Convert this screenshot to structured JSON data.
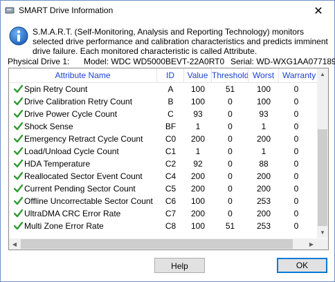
{
  "window": {
    "title": "SMART Drive Information",
    "close_glyph": "✕"
  },
  "info": {
    "text": "S.M.A.R.T. (Self-Monitoring, Analysis and Reporting Technology) monitors selected drive performance and calibration characteristics and predicts imminent drive failure. Each monitored characteristic is called Attribute."
  },
  "drive": {
    "label": "Physical Drive 1:",
    "model": "Model: WDC WD5000BEVT-22A0RT0",
    "serial": "Serial: WD-WXG1AA077189"
  },
  "table": {
    "headers": [
      "Attribute Name",
      "ID",
      "Value",
      "Threshold",
      "Worst",
      "Warranty"
    ],
    "rows": [
      {
        "name": "Spin Retry Count",
        "id": "A",
        "value": "100",
        "threshold": "51",
        "worst": "100",
        "warranty": "0"
      },
      {
        "name": "Drive Calibration Retry Count",
        "id": "B",
        "value": "100",
        "threshold": "0",
        "worst": "100",
        "warranty": "0"
      },
      {
        "name": "Drive Power Cycle Count",
        "id": "C",
        "value": "93",
        "threshold": "0",
        "worst": "93",
        "warranty": "0"
      },
      {
        "name": "Shock Sense",
        "id": "BF",
        "value": "1",
        "threshold": "0",
        "worst": "1",
        "warranty": "0"
      },
      {
        "name": "Emergency Retract Cycle Count",
        "id": "C0",
        "value": "200",
        "threshold": "0",
        "worst": "200",
        "warranty": "0"
      },
      {
        "name": "Load/Unload Cycle Count",
        "id": "C1",
        "value": "1",
        "threshold": "0",
        "worst": "1",
        "warranty": "0"
      },
      {
        "name": "HDA Temperature",
        "id": "C2",
        "value": "92",
        "threshold": "0",
        "worst": "88",
        "warranty": "0"
      },
      {
        "name": "Reallocated Sector Event Count",
        "id": "C4",
        "value": "200",
        "threshold": "0",
        "worst": "200",
        "warranty": "0"
      },
      {
        "name": "Current Pending Sector Count",
        "id": "C5",
        "value": "200",
        "threshold": "0",
        "worst": "200",
        "warranty": "0"
      },
      {
        "name": "Offline Uncorrectable Sector Count",
        "id": "C6",
        "value": "100",
        "threshold": "0",
        "worst": "253",
        "warranty": "0"
      },
      {
        "name": "UltraDMA CRC Error Rate",
        "id": "C7",
        "value": "200",
        "threshold": "0",
        "worst": "200",
        "warranty": "0"
      },
      {
        "name": "Multi Zone Error Rate",
        "id": "C8",
        "value": "100",
        "threshold": "51",
        "worst": "253",
        "warranty": "0"
      }
    ]
  },
  "buttons": {
    "help": "Help",
    "ok": "OK"
  },
  "colors": {
    "header_text": "#1c3fd3",
    "check_green": "#2e9b2e",
    "focus_border": "#0078d7"
  }
}
